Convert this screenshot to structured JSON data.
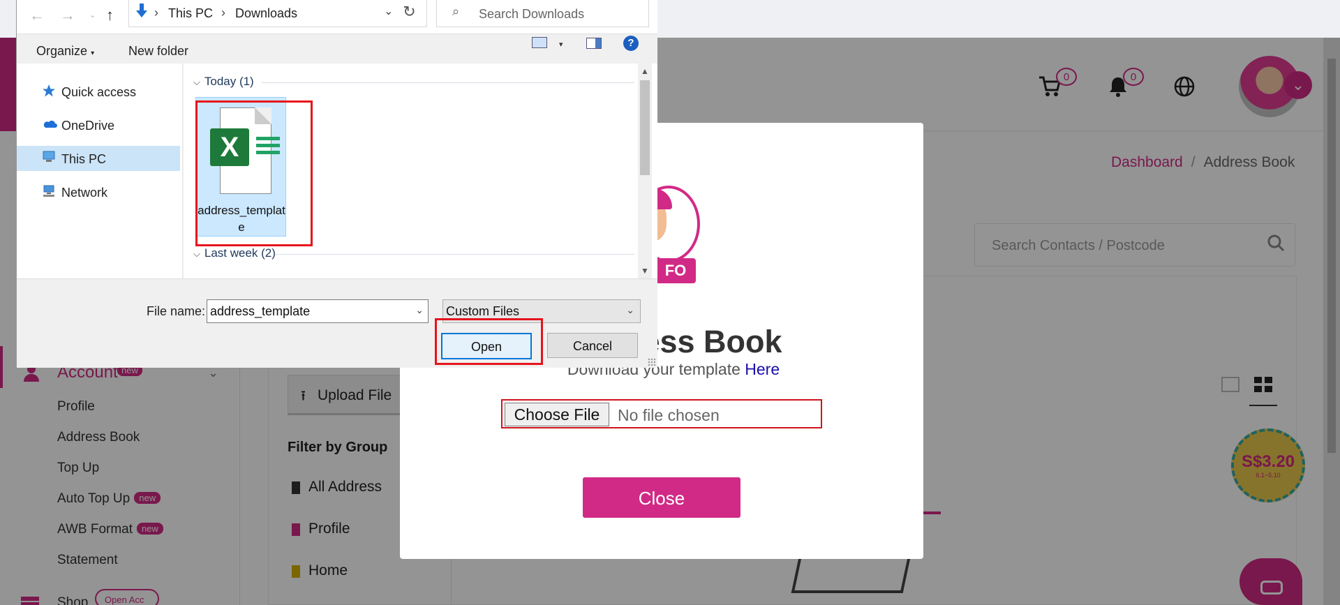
{
  "app": {
    "header": {
      "cart_count": "0",
      "notification_count": "0"
    },
    "breadcrumb": {
      "items": [
        "Dashboard",
        "Address Book"
      ],
      "separator": "/"
    },
    "search": {
      "placeholder": "Search Contacts / Postcode"
    },
    "sidebar": {
      "account_label": "Account",
      "account_badge": "new",
      "items": [
        {
          "label": "Profile",
          "badge": ""
        },
        {
          "label": "Address Book",
          "badge": ""
        },
        {
          "label": "Top Up",
          "badge": ""
        },
        {
          "label": "Auto Top Up",
          "badge": "new"
        },
        {
          "label": "AWB Format",
          "badge": "new"
        },
        {
          "label": "Statement",
          "badge": ""
        }
      ],
      "shop_label": "Shop",
      "shop_badge": "Open Acc"
    },
    "content": {
      "upload_label": "Upload File",
      "filter_title": "Filter by Group",
      "groups": [
        {
          "label": "All Address",
          "color": "#333333"
        },
        {
          "label": "Profile",
          "color": "#d12a86"
        },
        {
          "label": "Home",
          "color": "#d4b200"
        }
      ],
      "promo_amount": "S$3.20",
      "promo_sub": "6.1~5.10"
    }
  },
  "modal": {
    "mascot_tag": "FO",
    "title": "Address Book",
    "subtitle_prefix": "Download your template ",
    "subtitle_link": "Here",
    "choose_file_label": "Choose File",
    "no_file_text": "No file chosen",
    "close_label": "Close"
  },
  "file_dialog": {
    "address_path": [
      "This PC",
      "Downloads"
    ],
    "search_placeholder": "Search Downloads",
    "toolbar": {
      "organize_label": "Organize",
      "new_folder_label": "New folder",
      "help_label": "?"
    },
    "nav_items": [
      {
        "label": "Quick access",
        "icon": "star-icon"
      },
      {
        "label": "OneDrive",
        "icon": "cloud-icon"
      },
      {
        "label": "This PC",
        "icon": "computer-icon"
      },
      {
        "label": "Network",
        "icon": "network-icon"
      }
    ],
    "groups": [
      {
        "label": "Today (1)"
      },
      {
        "label": "Last week (2)"
      }
    ],
    "file": {
      "name": "address_template",
      "icon": "excel-file-icon"
    },
    "file_name_label": "File name:",
    "file_name_value": "address_template",
    "file_type_value": "Custom Files",
    "open_label": "Open",
    "cancel_label": "Cancel"
  },
  "colors": {
    "brand": "#d12a86",
    "annotation": "#e6141c",
    "selection": "#cce8ff"
  }
}
